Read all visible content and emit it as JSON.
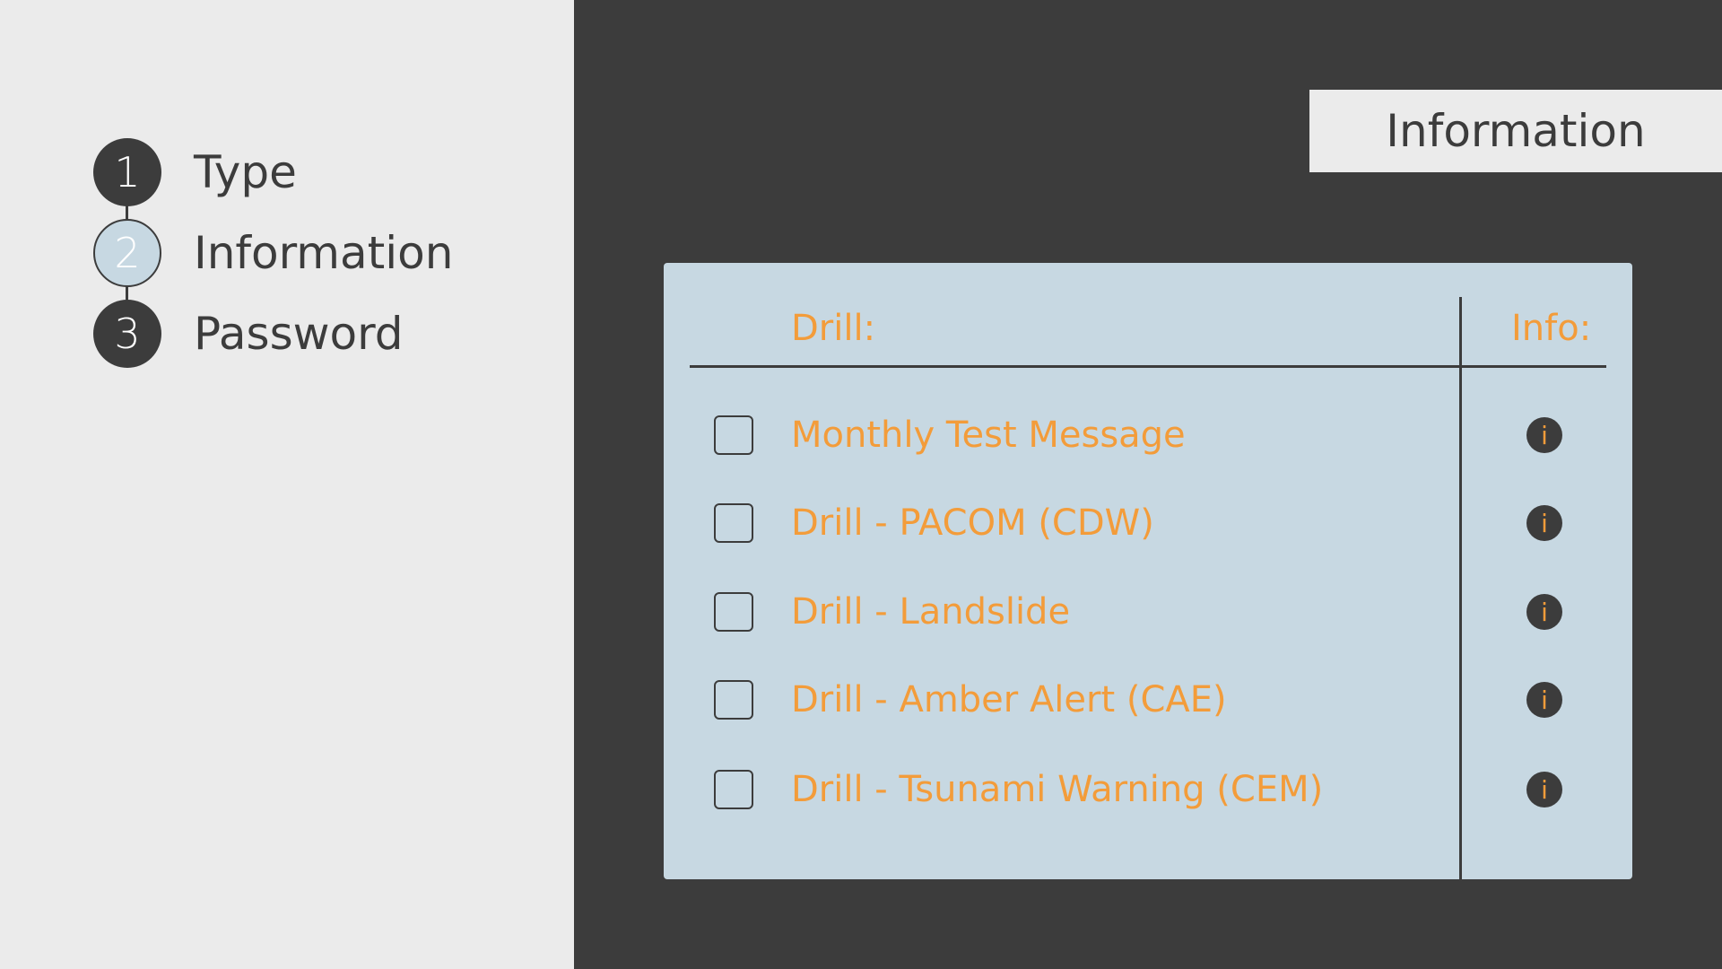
{
  "steps": [
    {
      "number": "1",
      "label": "Type",
      "state": "done"
    },
    {
      "number": "2",
      "label": "Information",
      "state": "active"
    },
    {
      "number": "3",
      "label": "Password",
      "state": "pending"
    }
  ],
  "header": {
    "title": "Information"
  },
  "table": {
    "columns": {
      "drill": "Drill:",
      "info": "Info:"
    },
    "rows": [
      {
        "label": "Monthly Test Message",
        "checked": false
      },
      {
        "label": "Drill - PACOM (CDW)",
        "checked": false
      },
      {
        "label": "Drill - Landslide",
        "checked": false
      },
      {
        "label": "Drill - Amber Alert (CAE)",
        "checked": false
      },
      {
        "label": "Drill - Tsunami Warning (CEM)",
        "checked": false
      }
    ],
    "info_icon_glyph": "i"
  },
  "icons": {
    "row_info": "info-icon"
  },
  "colors": {
    "dark": "#3c3c3c",
    "panel": "#ebebeb",
    "card": "#c7d8e2",
    "accent": "#f39c3a"
  }
}
